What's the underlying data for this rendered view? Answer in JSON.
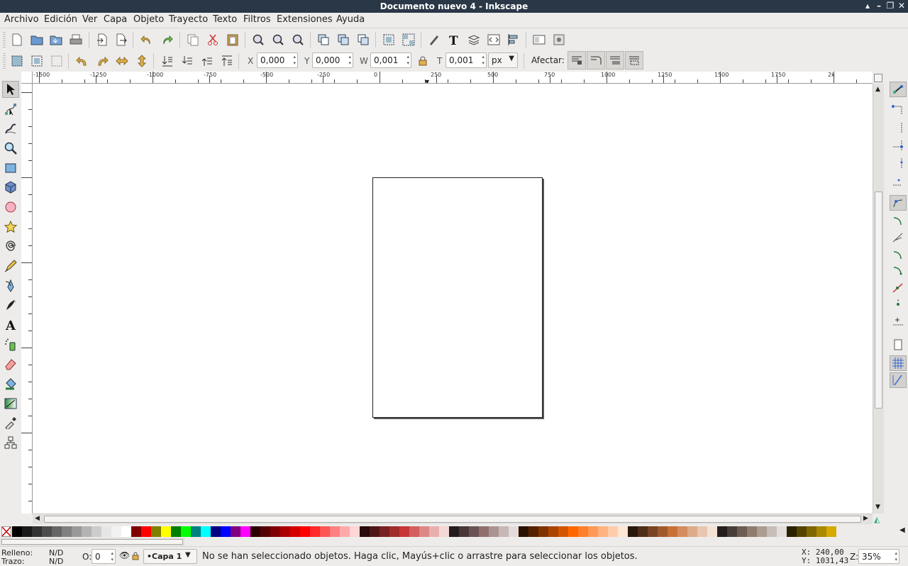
{
  "window": {
    "title": "Documento nuevo 4 - Inkscape"
  },
  "menu": [
    "Archivo",
    "Edición",
    "Ver",
    "Capa",
    "Objeto",
    "Trayecto",
    "Texto",
    "Filtros",
    "Extensiones",
    "Ayuda"
  ],
  "toolbar": {
    "x_label": "X",
    "x_value": "0,000",
    "y_label": "Y",
    "y_value": "0,000",
    "w_label": "W",
    "w_value": "0,001",
    "h_label": "T",
    "h_value": "0,001",
    "unit": "px",
    "affect_label": "Afectar:"
  },
  "ruler": {
    "h_ticks": [
      "-1500",
      "-1250",
      "-1000",
      "-750",
      "-500",
      "-250",
      "0",
      "250",
      "500",
      "750",
      "1000",
      "1250",
      "1500",
      "1750",
      "2k"
    ]
  },
  "tools": [
    "selector-icon",
    "node-icon",
    "tweak-icon",
    "zoom-icon",
    "rect-icon",
    "3dbox-icon",
    "ellipse-icon",
    "star-icon",
    "spiral-icon",
    "pencil-icon",
    "pen-icon",
    "calligraphy-icon",
    "text-icon",
    "spray-icon",
    "eraser-icon",
    "bucket-icon",
    "gradient-icon",
    "dropper-icon",
    "connector-icon"
  ],
  "palette_colors": [
    "#000000",
    "#1a1a1a",
    "#333333",
    "#4d4d4d",
    "#666666",
    "#808080",
    "#999999",
    "#b3b3b3",
    "#cccccc",
    "#e6e6e6",
    "#f2f2f2",
    "#ffffff",
    "#800000",
    "#ff0000",
    "#808000",
    "#ffff00",
    "#008000",
    "#00ff00",
    "#008080",
    "#00ffff",
    "#000080",
    "#0000ff",
    "#800080",
    "#ff00ff",
    "#2b0000",
    "#550000",
    "#800000",
    "#aa0000",
    "#d40000",
    "#ff0000",
    "#ff2a2a",
    "#ff5555",
    "#ff8080",
    "#ffaaaa",
    "#ffd5d5",
    "#280b0b",
    "#501616",
    "#782121",
    "#a02c2c",
    "#c83737",
    "#d35f5f",
    "#de8787",
    "#e9afaf",
    "#f4d7d7",
    "#241c1c",
    "#483737",
    "#6c5353",
    "#916f6f",
    "#ac9393",
    "#c8b7b7",
    "#e3dbdb",
    "#2b1100",
    "#552200",
    "#803300",
    "#aa4400",
    "#d45500",
    "#ff6600",
    "#ff7f2a",
    "#ff9955",
    "#ffb380",
    "#ffccaa",
    "#ffe6d5",
    "#28170b",
    "#502d16",
    "#784421",
    "#a05a2c",
    "#c87137",
    "#d38d5f",
    "#deaa87",
    "#e9c6af",
    "#f4e3d7",
    "#241f1c",
    "#483e37",
    "#6c5d53",
    "#917c6f",
    "#ac9d93",
    "#c8beb7",
    "#e3dedb",
    "#2b2200",
    "#554400",
    "#806600",
    "#aa8800",
    "#d4aa00"
  ],
  "status": {
    "fill_label": "Relleno:",
    "fill_value": "N/D",
    "stroke_label": "Trazo:",
    "stroke_value": "N/D",
    "opacity_label": "O:",
    "opacity_value": "0",
    "layer": "•Capa 1",
    "message": "No se han seleccionado objetos. Haga clic, Mayús+clic o arrastre para seleccionar los objetos.",
    "x_coord": "X:  240,00",
    "y_coord": "Y: 1031,43",
    "zoom_label": "Z:",
    "zoom_value": "35%"
  }
}
